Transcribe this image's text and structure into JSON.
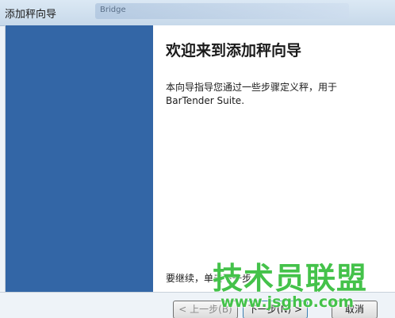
{
  "window": {
    "title": "添加秤向导",
    "background_tab_text": "Bridge"
  },
  "wizard": {
    "heading": "欢迎来到添加秤向导",
    "description": "本向导指导您通过一些步骤定义秤，用于 BarTender Suite.",
    "continue_text": "要继续，单击下一步。"
  },
  "buttons": {
    "back_label": "< 上一步(B)",
    "next_label": "下一步(N) >",
    "cancel_label": "取消"
  },
  "watermark": {
    "main_text": "技术员联盟",
    "url_text": "www.jsgho.com"
  },
  "colors": {
    "side_panel": "#3366a6",
    "watermark": "#44c24a"
  }
}
